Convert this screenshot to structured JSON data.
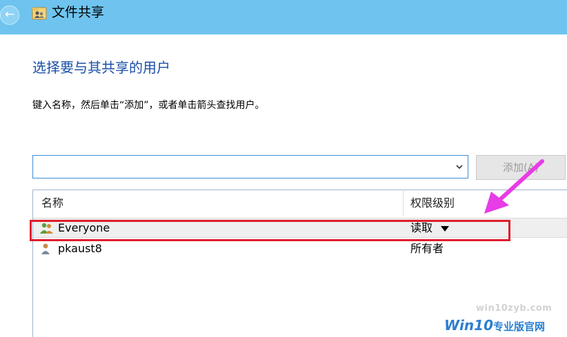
{
  "window": {
    "title": "文件共享",
    "back_icon": "back-arrow-icon",
    "app_icon": "share-users-icon",
    "titlebar_color": "#6ec4ef"
  },
  "main": {
    "heading": "选择要与其共享的用户",
    "instruction": "键入名称，然后单击“添加”，或者单击箭头查找用户。",
    "user_input": {
      "value": "",
      "placeholder": ""
    },
    "dropdown_icon": "chevron-down-icon",
    "add_button_label": "添加(A)"
  },
  "table": {
    "columns": [
      "名称",
      "权限级别"
    ],
    "rows": [
      {
        "icon": "group-users-icon",
        "name": "Everyone",
        "permission": "读取",
        "has_dropdown": true,
        "selected": true
      },
      {
        "icon": "user-icon",
        "name": "pkaust8",
        "permission": "所有者",
        "has_dropdown": false,
        "selected": false
      }
    ]
  },
  "annotations": {
    "highlight_color": "#e01c2c",
    "arrow_color": "#e83ce6"
  },
  "watermark": {
    "url": "win10zyb.com",
    "brand": "Win10",
    "brand_suffix": "专业版官网"
  }
}
